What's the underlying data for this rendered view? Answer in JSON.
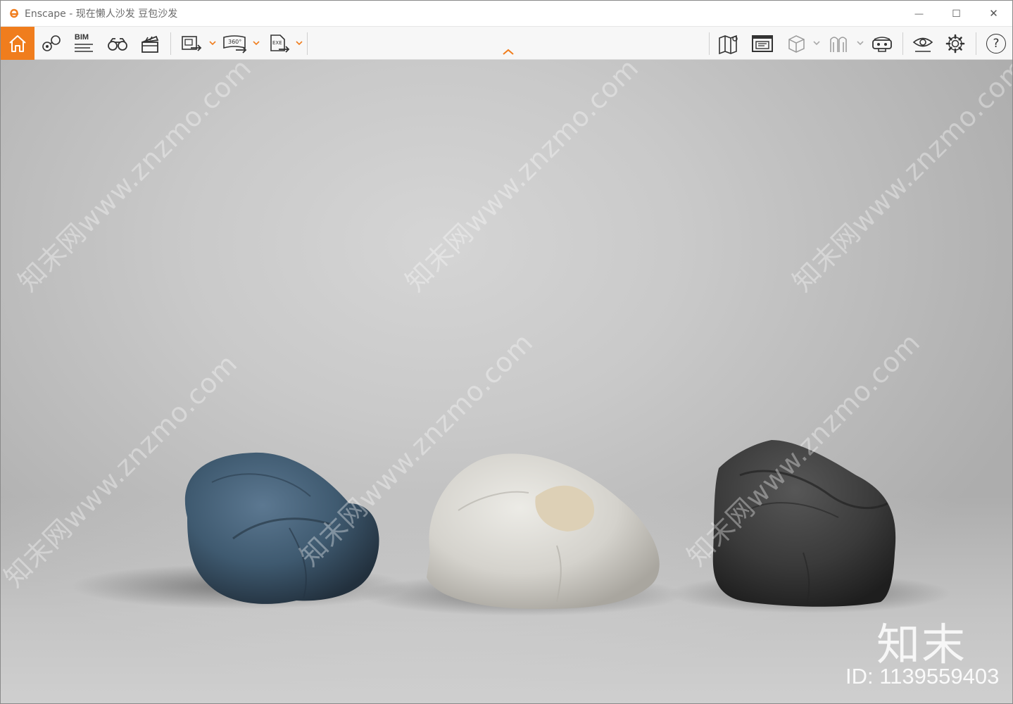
{
  "window": {
    "title": "Enscape - 现在懒人沙发 豆包沙发",
    "controls": {
      "minimize": "—",
      "maximize": "☐",
      "close": "✕"
    }
  },
  "toolbar": {
    "accent_color": "#f07d1d",
    "left_items": [
      {
        "name": "home-icon"
      },
      {
        "name": "views-icon"
      },
      {
        "name": "bim-icon",
        "label": "BIM"
      },
      {
        "name": "binoculars-icon"
      },
      {
        "name": "video-clapper-icon"
      },
      {
        "name": "screenshot-export-icon",
        "has_dropdown": true
      },
      {
        "name": "panorama-export-icon",
        "label": "360°",
        "has_dropdown": true
      },
      {
        "name": "exe-export-icon",
        "label": "EXE",
        "has_dropdown": true
      }
    ],
    "right_items": [
      {
        "name": "map-icon"
      },
      {
        "name": "web-standalone-icon"
      },
      {
        "name": "cube-view-icon",
        "has_dropdown": true
      },
      {
        "name": "asset-library-icon",
        "has_dropdown": true
      },
      {
        "name": "vr-headset-icon"
      },
      {
        "name": "visual-settings-icon"
      },
      {
        "name": "settings-gear-icon"
      },
      {
        "name": "help-icon",
        "label": "?"
      }
    ]
  },
  "viewport": {
    "watermark_text": "知末网www.znzmo.com",
    "brand_logo": "知末",
    "brand_id": "ID: 1139559403",
    "objects": [
      {
        "name": "blue-bean-bag",
        "color": "#3f5a70"
      },
      {
        "name": "white-bean-bag",
        "color": "#d9d7d2"
      },
      {
        "name": "black-bean-bag",
        "color": "#3a3a3a"
      }
    ]
  }
}
